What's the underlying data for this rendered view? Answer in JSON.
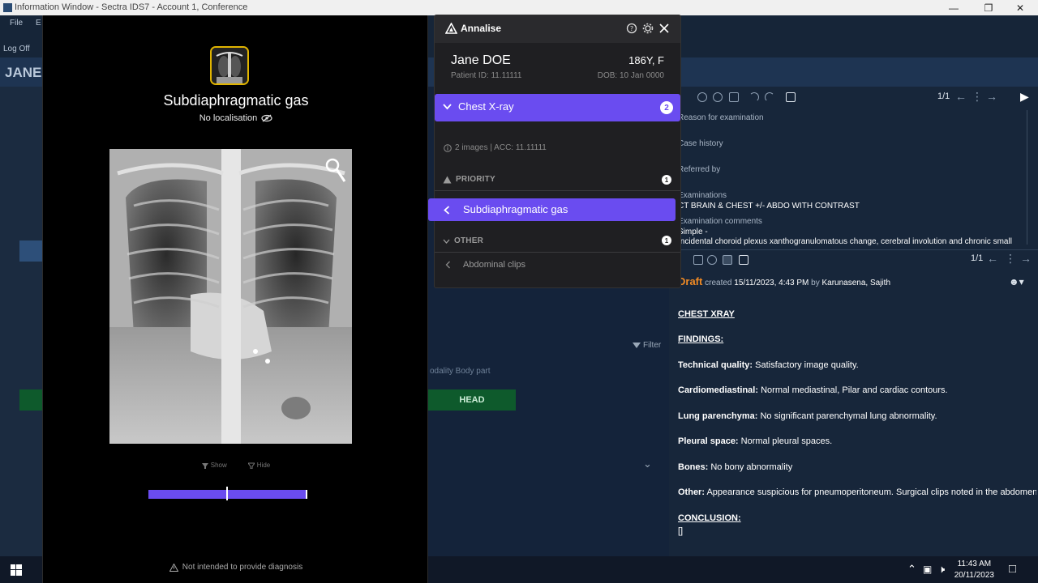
{
  "window": {
    "title": "Information Window - Sectra IDS7 - Account 1, Conference"
  },
  "background_app": {
    "menu": [
      "File",
      "E"
    ],
    "logoff_label": "Log Off",
    "patient_name_partial": "JANE",
    "pager_top": "1/1",
    "pager_bottom": "1/1",
    "filter_label": "Filter",
    "modality_body_part": "odality Body part",
    "head_button": "HEAD",
    "info_fields": [
      {
        "label": "Reason for examination",
        "value": ""
      },
      {
        "label": "Case history",
        "value": ""
      },
      {
        "label": "Referred by",
        "value": ""
      },
      {
        "label": "Examinations",
        "value": "CT BRAIN & CHEST  +/- ABDO WITH CONTRAST"
      },
      {
        "label": "Examination comments",
        "value": "Simple -"
      }
    ],
    "exam_comment_line2": "Incidental choroid plexus xanthogranulomatous change, cerebral involution and chronic small",
    "report": {
      "status": "Draft",
      "created_word": "created",
      "created_at": "15/11/2023, 4:43 PM",
      "by_word": "by",
      "author": "Karunasena, Sajith",
      "heading": "CHEST XRAY",
      "findings_heading": "FINDINGS:",
      "lines": [
        {
          "label": "Technical quality:",
          "text": "Satisfactory image quality."
        },
        {
          "label": "Cardiomediastinal:",
          "text": "Normal mediastinal, Pilar and cardiac contours."
        },
        {
          "label": "Lung parenchyma:",
          "text": "No significant parenchymal lung abnormality."
        },
        {
          "label": "Pleural space:",
          "text": "Normal pleural spaces."
        },
        {
          "label": "Bones:",
          "text": "No bony abnormality"
        },
        {
          "label": "Other:",
          "text": "Appearance suspicious for pneumoperitoneum. Surgical clips noted in the abdomen."
        }
      ],
      "conclusion_heading": "CONCLUSION:",
      "conclusion_text": "[]"
    }
  },
  "taskbar": {
    "time": "11:43 AM",
    "date": "20/11/2023"
  },
  "viewer": {
    "finding_title": "Subdiaphragmatic gas",
    "localisation": "No localisation",
    "show_label": "Show",
    "hide_label": "Hide",
    "disclaimer": "Not intended to provide diagnosis"
  },
  "annalise": {
    "brand": "Annalise",
    "patient_name": "Jane DOE",
    "age_sex": "186Y, F",
    "patient_id": "Patient ID: 11.11111",
    "dob": "DOB: 10 Jan 0000",
    "study": {
      "label": "Chest X-ray",
      "count": "2"
    },
    "study_meta": "2 images | ACC: 11.11111",
    "priority": {
      "label": "PRIORITY",
      "count": "1",
      "finding": "Subdiaphragmatic gas"
    },
    "other": {
      "label": "OTHER",
      "count": "1",
      "finding": "Abdominal clips"
    }
  },
  "colors": {
    "accent": "#6a4cf0",
    "draft": "#f08a24",
    "head_button": "#0e5a2c"
  }
}
